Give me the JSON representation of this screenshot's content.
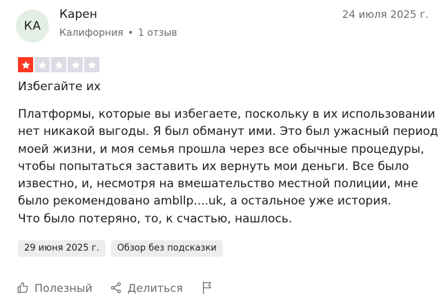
{
  "author": {
    "initials": "КА",
    "name": "Карен",
    "location": "Калифорния",
    "reviews_count": "1 отзыв"
  },
  "review": {
    "date": "24 июля 2025 г.",
    "rating": 1,
    "rating_max": 5,
    "title": "Избегайте их",
    "body_lines": [
      "Платформы, которые вы избегаете, поскольку в их использовании",
      "нет никакой выгоды. Я был обманут ими. Это был ужасный период",
      "моей жизни, и моя семья прошла через все обычные процедуры,",
      "чтобы попытаться заставить их вернуть мои деньги. Все было",
      "известно, и, несмотря на вмешательство местной полиции, мне",
      "было рекомендовано ambllp....uk, а остальное уже история.",
      "Что было потеряно, то, к счастью, нашлось."
    ],
    "experience_date": "29 июня 2025 г.",
    "tag": "Обзор без подсказки"
  },
  "actions": {
    "useful_label": "Полезный",
    "share_label": "Делиться",
    "useful_icon": "thumbs-up-icon",
    "share_icon": "share-icon",
    "flag_icon": "flag-icon"
  },
  "colors": {
    "star_filled": "#ff3722",
    "star_empty": "#dcdce6",
    "avatar_bg": "#e3efe4",
    "muted_text": "#6b6b6b",
    "tag_bg": "#ededed"
  }
}
